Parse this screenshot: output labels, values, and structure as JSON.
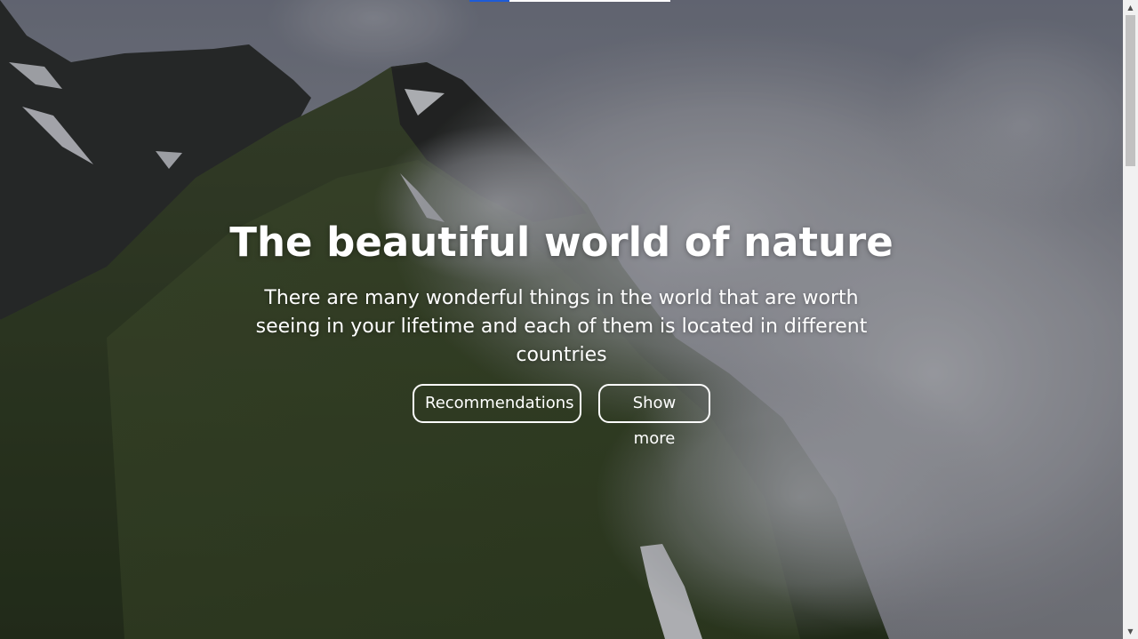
{
  "hero": {
    "title": "The beautiful world of nature",
    "subtitle": "There are many wonderful things in the world that are worth seeing in your lifetime and each of them is located in different countries",
    "buttons": {
      "recommendations_label": "Recommendations",
      "show_more_label": "Show more"
    },
    "background_image": "mountain-ridge-clouds"
  },
  "slider_progress": {
    "fraction": 0.2,
    "track_color": "#ffffff",
    "fill_color": "#1e5bd6"
  },
  "scrollbar": {
    "up_icon": "scroll-up-arrow-icon",
    "down_icon": "scroll-down-arrow-icon"
  },
  "colors": {
    "text": "#ffffff",
    "button_border": "#ffffff",
    "scroll_track": "#f1f1f1",
    "scroll_thumb": "#c1c1c1"
  }
}
